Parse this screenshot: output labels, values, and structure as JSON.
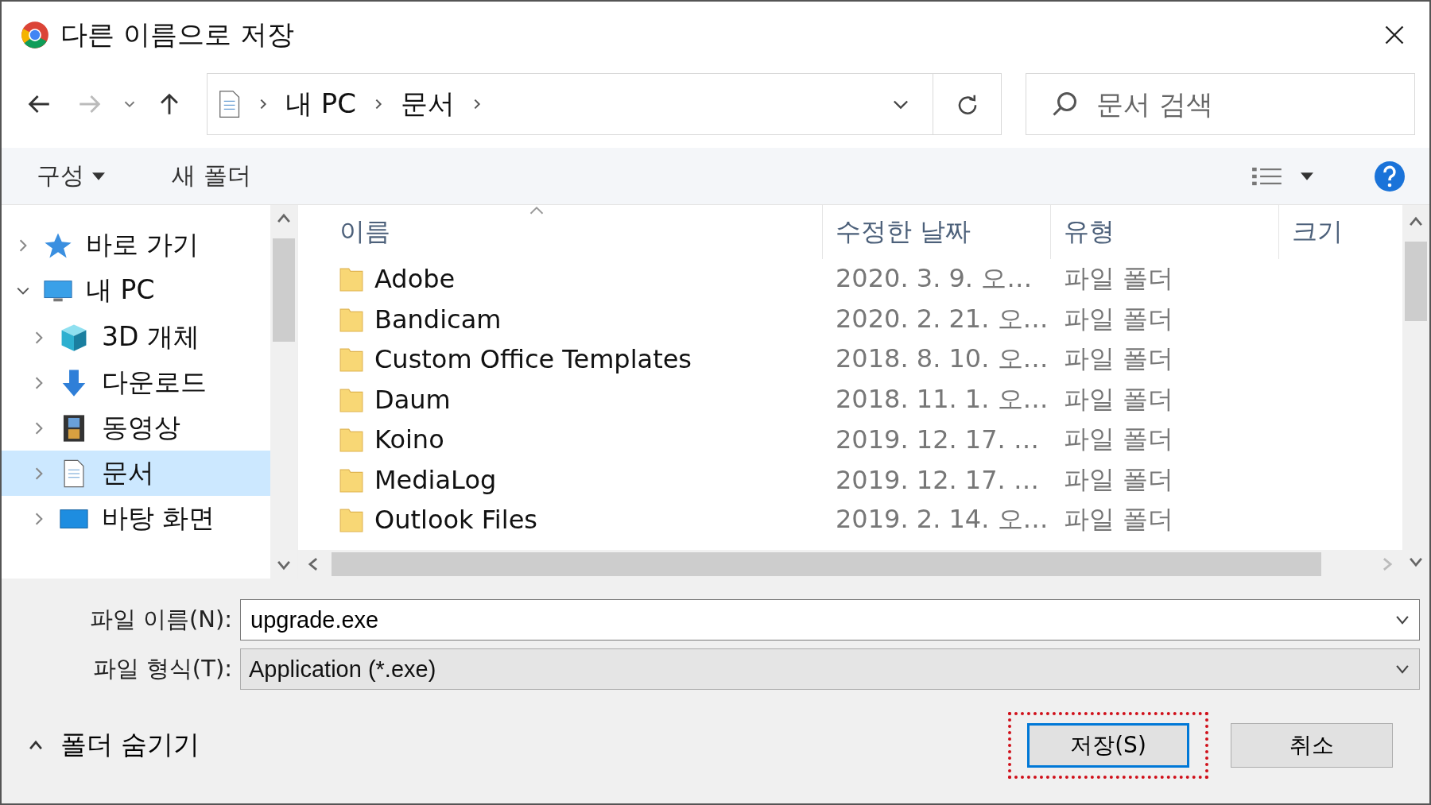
{
  "window": {
    "title": "다른 이름으로 저장"
  },
  "address": {
    "path": [
      "내 PC",
      "문서"
    ]
  },
  "search": {
    "placeholder": "문서 검색"
  },
  "toolbar": {
    "organize": "구성",
    "new_folder": "새 폴더"
  },
  "nav": [
    {
      "label": "바로 가기",
      "kind": "star",
      "expanded": false,
      "selected": false
    },
    {
      "label": "내 PC",
      "kind": "pc",
      "expanded": true,
      "selected": false,
      "children": [
        {
          "label": "3D 개체",
          "kind": "cube",
          "expanded": false,
          "selected": false
        },
        {
          "label": "다운로드",
          "kind": "download",
          "expanded": false,
          "selected": false
        },
        {
          "label": "동영상",
          "kind": "video",
          "expanded": false,
          "selected": false
        },
        {
          "label": "문서",
          "kind": "doc",
          "expanded": false,
          "selected": true
        },
        {
          "label": "바탕 화면",
          "kind": "desktop",
          "expanded": false,
          "selected": false
        }
      ]
    }
  ],
  "columns": [
    "이름",
    "수정한 날짜",
    "유형",
    "크기"
  ],
  "rows": [
    {
      "name": "Adobe",
      "date": "2020. 3. 9. 오…",
      "type": "파일 폴더"
    },
    {
      "name": "Bandicam",
      "date": "2020. 2. 21. 오…",
      "type": "파일 폴더"
    },
    {
      "name": "Custom Office Templates",
      "date": "2018. 8. 10. 오…",
      "type": "파일 폴더"
    },
    {
      "name": "Daum",
      "date": "2018. 11. 1. 오…",
      "type": "파일 폴더"
    },
    {
      "name": "Koino",
      "date": "2019. 12. 17. …",
      "type": "파일 폴더"
    },
    {
      "name": "MediaLog",
      "date": "2019. 12. 17. …",
      "type": "파일 폴더"
    },
    {
      "name": "Outlook Files",
      "date": "2019. 2. 14. 오…",
      "type": "파일 폴더"
    }
  ],
  "file_name": {
    "label": "파일 이름(N):",
    "value": "upgrade.exe"
  },
  "file_type": {
    "label": "파일 형식(T):",
    "value": "Application (*.exe)"
  },
  "hide_folders": "폴더 숨기기",
  "buttons": [
    {
      "label": "저장(S)",
      "kind": "primary",
      "highlighted": true
    },
    {
      "label": "취소",
      "kind": "secondary",
      "highlighted": false
    }
  ]
}
